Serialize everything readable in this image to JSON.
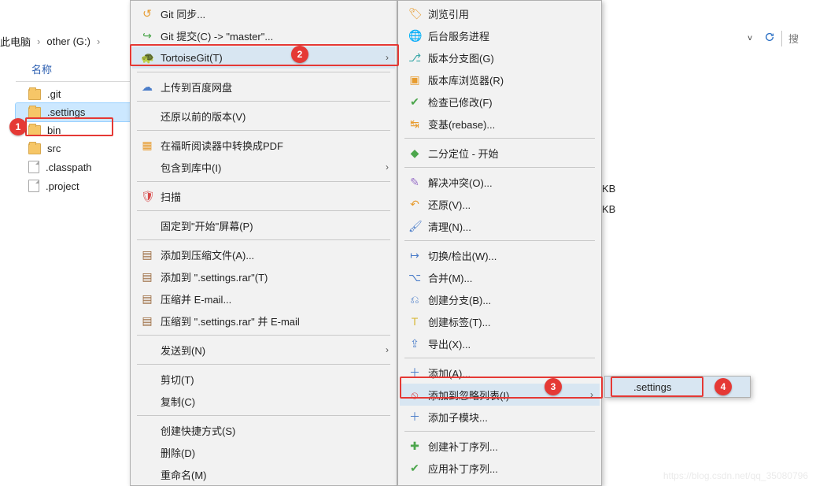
{
  "breadcrumb": {
    "item0": "此电脑",
    "item1": "other (G:)"
  },
  "right": {
    "search": "搜"
  },
  "panel": {
    "header": "名称"
  },
  "files": {
    "git": ".git",
    "settings": ".settings",
    "bin": "bin",
    "src": "src",
    "classpath": ".classpath",
    "project": ".project"
  },
  "kb": {
    "row1": "KB",
    "row2": "KB"
  },
  "menu1": {
    "git_sync": "Git 同步...",
    "git_commit": "Git 提交(C) -> \"master\"...",
    "tortoise": "TortoiseGit(T)",
    "upload": "上传到百度网盘",
    "restore": "还原以前的版本(V)",
    "foxit": "在福昕阅读器中转换成PDF",
    "library": "包含到库中(I)",
    "scan": "扫描",
    "pin": "固定到\"开始\"屏幕(P)",
    "rar_add": "添加到压缩文件(A)...",
    "rar_name": "添加到 \".settings.rar\"(T)",
    "rar_mail": "压缩并 E-mail...",
    "rar_name_mail": "压缩到 \".settings.rar\" 并 E-mail",
    "sendto": "发送到(N)",
    "cut": "剪切(T)",
    "copy": "复制(C)",
    "shortcut": "创建快捷方式(S)",
    "delete": "删除(D)",
    "rename": "重命名(M)"
  },
  "menu2": {
    "browse_ref": "浏览引用",
    "daemon": "后台服务进程",
    "rev_graph": "版本分支图(G)",
    "repo_browser": "版本库浏览器(R)",
    "check_mods": "检查已修改(F)",
    "rebase": "变基(rebase)...",
    "bisect": "二分定位 - 开始",
    "resolve": "解决冲突(O)...",
    "revert": "还原(V)...",
    "cleanup": "清理(N)...",
    "switch": "切换/检出(W)...",
    "merge": "合并(M)...",
    "branch": "创建分支(B)...",
    "tag": "创建标签(T)...",
    "export": "导出(X)...",
    "add": "添加(A)...",
    "ignore": "添加到忽略列表(I)",
    "submodule": "添加子模块...",
    "create_patch": "创建补丁序列...",
    "apply_patch": "应用补丁序列..."
  },
  "menu3": {
    "settings": ".settings"
  },
  "badges": {
    "b1": "1",
    "b2": "2",
    "b3": "3",
    "b4": "4"
  },
  "watermark": "https://blog.csdn.net/qq_35080796"
}
